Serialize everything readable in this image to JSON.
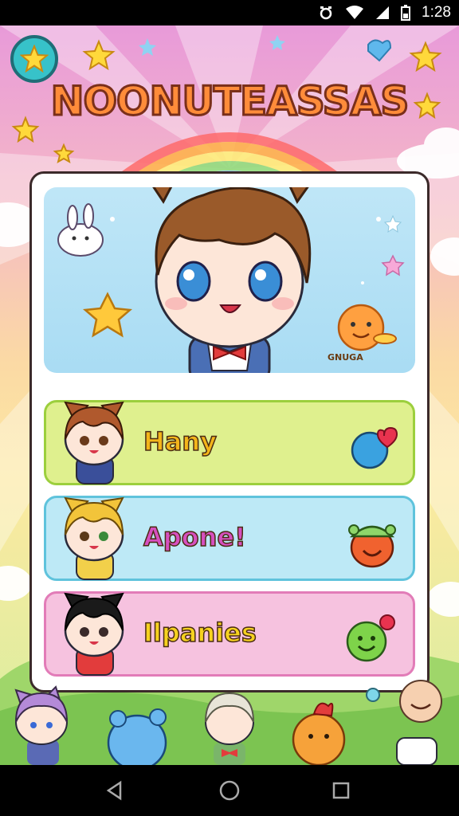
{
  "status_bar": {
    "time": "1:28"
  },
  "game": {
    "title": "NOONUTEASSAS",
    "hero_tag": "GNUGA"
  },
  "menu": [
    {
      "label": "Hany",
      "color": "#dff08e",
      "border": "#9ccf3d",
      "text_color": "#f3b51a"
    },
    {
      "label": "Apone!",
      "color": "#bde9f6",
      "border": "#5fc3dc",
      "text_color": "#d64fbf"
    },
    {
      "label": "Ilpanies",
      "color": "#f6c2df",
      "border": "#e27cb8",
      "text_color": "#f6d21f"
    }
  ],
  "colors": {
    "accent": "#37c2c9",
    "panel_border": "#3b2a2a"
  },
  "icons": [
    "star-icon",
    "heart-balloon-icon",
    "smiling-creature-icon",
    "green-slime-icon"
  ]
}
